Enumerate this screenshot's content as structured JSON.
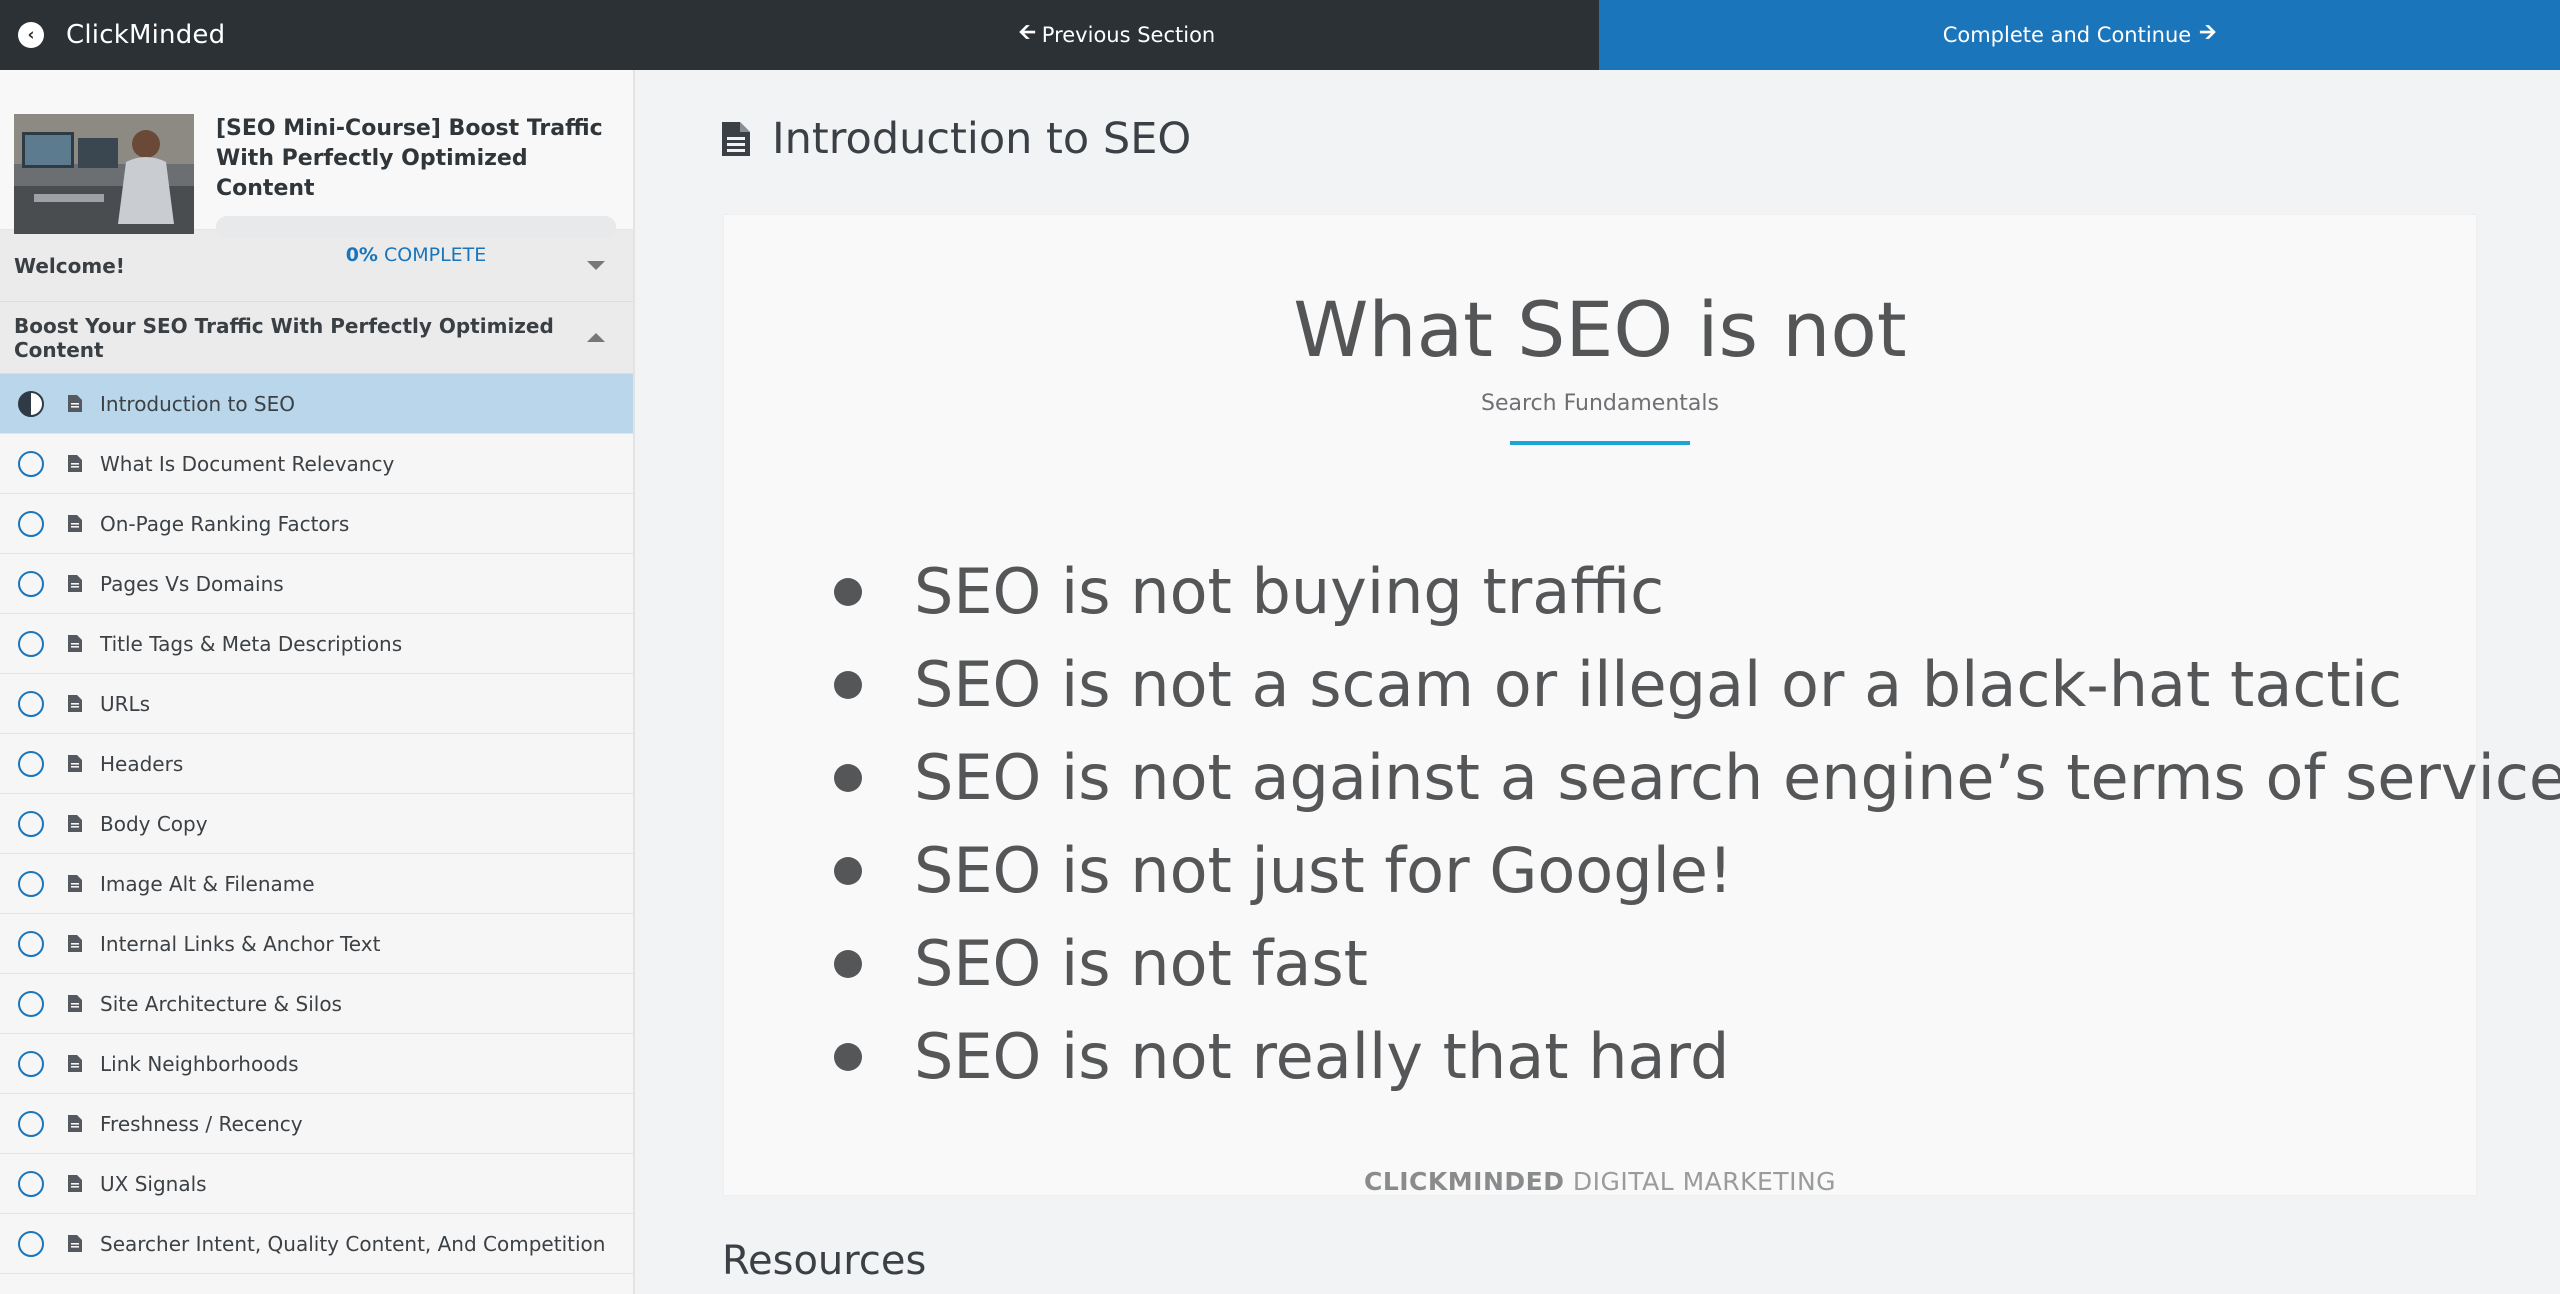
{
  "topbar": {
    "brand": "ClickMinded",
    "prev_label": "Previous Section",
    "complete_label": "Complete and Continue"
  },
  "course": {
    "title": "[SEO Mini-Course] Boost Traffic With Perfectly Optimized Content",
    "progress_value": "0%",
    "progress_suffix": "COMPLETE",
    "progress_fraction": 0
  },
  "sections": [
    {
      "title": "Welcome!",
      "expanded": false
    },
    {
      "title": "Boost Your SEO Traffic With Perfectly Optimized Content",
      "expanded": true
    }
  ],
  "lessons": [
    {
      "label": "Introduction to SEO",
      "status": "in-progress",
      "active": true
    },
    {
      "label": "What Is Document Relevancy",
      "status": "not-started"
    },
    {
      "label": "On-Page Ranking Factors",
      "status": "not-started"
    },
    {
      "label": "Pages Vs Domains",
      "status": "not-started"
    },
    {
      "label": "Title Tags & Meta Descriptions",
      "status": "not-started"
    },
    {
      "label": "URLs",
      "status": "not-started"
    },
    {
      "label": "Headers",
      "status": "not-started"
    },
    {
      "label": "Body Copy",
      "status": "not-started"
    },
    {
      "label": "Image Alt & Filename",
      "status": "not-started"
    },
    {
      "label": "Internal Links & Anchor Text",
      "status": "not-started"
    },
    {
      "label": "Site Architecture & Silos",
      "status": "not-started"
    },
    {
      "label": "Link Neighborhoods",
      "status": "not-started"
    },
    {
      "label": "Freshness / Recency",
      "status": "not-started"
    },
    {
      "label": "UX Signals",
      "status": "not-started"
    },
    {
      "label": "Searcher Intent, Quality Content, And Competition",
      "status": "not-started"
    }
  ],
  "lecture": {
    "title": "Introduction to SEO",
    "slide": {
      "title": "What SEO is not",
      "subtitle": "Search Fundamentals",
      "bullets": [
        "SEO is not buying traffic",
        "SEO is not a scam or illegal or a black-hat tactic",
        "SEO is not against a search engine’s terms of service",
        "SEO is not just for Google!",
        "SEO is not fast",
        "SEO is not really that hard"
      ],
      "footer_bold": "CLICKMINDED",
      "footer_rest": " DIGITAL MARKETING"
    },
    "resources_heading": "Resources"
  },
  "colors": {
    "topbar": "#2b3135",
    "accent": "#1b75bb",
    "active_lesson": "#bad6ea",
    "slide_rule": "#19a6d6"
  },
  "icons": {
    "back": "circle-arrow-left-icon",
    "prev": "arrow-left-icon",
    "next": "arrow-right-icon",
    "lesson_type": "document-icon",
    "status": "circle-status-icon"
  }
}
